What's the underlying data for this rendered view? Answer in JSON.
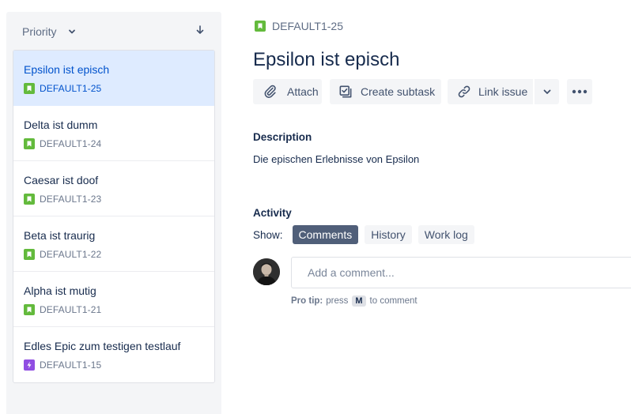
{
  "sidebar": {
    "sort_label": "Priority",
    "issues": [
      {
        "summary": "Epsilon ist episch",
        "key": "DEFAULT1-25",
        "type": "story",
        "selected": true
      },
      {
        "summary": "Delta ist dumm",
        "key": "DEFAULT1-24",
        "type": "story",
        "selected": false
      },
      {
        "summary": "Caesar ist doof",
        "key": "DEFAULT1-23",
        "type": "story",
        "selected": false
      },
      {
        "summary": "Beta ist traurig",
        "key": "DEFAULT1-22",
        "type": "story",
        "selected": false
      },
      {
        "summary": "Alpha ist mutig",
        "key": "DEFAULT1-21",
        "type": "story",
        "selected": false
      },
      {
        "summary": "Edles Epic zum testigen testlauf",
        "key": "DEFAULT1-15",
        "type": "epic",
        "selected": false
      }
    ]
  },
  "issue": {
    "key": "DEFAULT1-25",
    "title": "Epsilon ist episch",
    "description_heading": "Description",
    "description": "Die epischen Erlebnisse von Epsilon"
  },
  "toolbar": {
    "attach_label": "Attach",
    "subtask_label": "Create subtask",
    "link_label": "Link issue"
  },
  "activity": {
    "heading": "Activity",
    "show_label": "Show:",
    "tabs": [
      "Comments",
      "History",
      "Work log"
    ],
    "active_tab": "Comments",
    "comment_placeholder": "Add a comment...",
    "pro_tip_label": "Pro tip:",
    "pro_tip_pre": "press",
    "pro_tip_key": "M",
    "pro_tip_post": "to comment"
  },
  "colors": {
    "story": "#63ba3c",
    "epic": "#904ee2",
    "selected_bg": "#deebff",
    "link_blue": "#0052cc"
  }
}
